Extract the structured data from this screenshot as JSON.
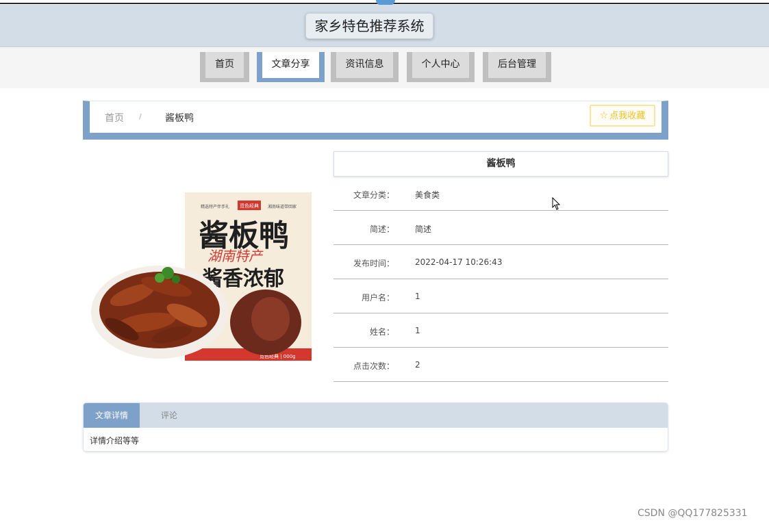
{
  "site": {
    "title": "家乡特色推荐系统"
  },
  "nav": {
    "items": [
      {
        "label": "首页"
      },
      {
        "label": "文章分享"
      },
      {
        "label": "资讯信息"
      },
      {
        "label": "个人中心"
      },
      {
        "label": "后台管理"
      }
    ],
    "active_index": 1
  },
  "breadcrumb": {
    "home": "首页",
    "separator": "/",
    "current": "酱板鸭"
  },
  "favorite_button": {
    "label": "点我收藏",
    "icon": "star-outline-icon"
  },
  "product": {
    "image": {
      "package_title": "酱板鸭",
      "package_subtitle": "湖南特产",
      "package_slogan": "酱香浓郁",
      "brand": "觅色经典",
      "badge_left": "精选特产伴手礼",
      "badge_right": "湘南味道带回家",
      "bottom_text": "觅色经典 | 000g"
    },
    "title": "酱板鸭",
    "fields": [
      {
        "label": "文章分类：",
        "value": "美食类"
      },
      {
        "label": "简述：",
        "value": "简述"
      },
      {
        "label": "发布时间：",
        "value": "2022-04-17 10:26:43"
      },
      {
        "label": "用户名：",
        "value": "1"
      },
      {
        "label": "姓名：",
        "value": "1"
      },
      {
        "label": "点击次数：",
        "value": "2"
      }
    ]
  },
  "tabs": {
    "items": [
      {
        "label": "文章详情"
      },
      {
        "label": "评论"
      }
    ],
    "active_index": 0,
    "content": "详情介绍等等"
  },
  "watermark": "CSDN @QQ177825331",
  "colors": {
    "accent": "#7ea1c9",
    "header_bg": "#d3dde7",
    "favorite": "#f4bf1e"
  }
}
